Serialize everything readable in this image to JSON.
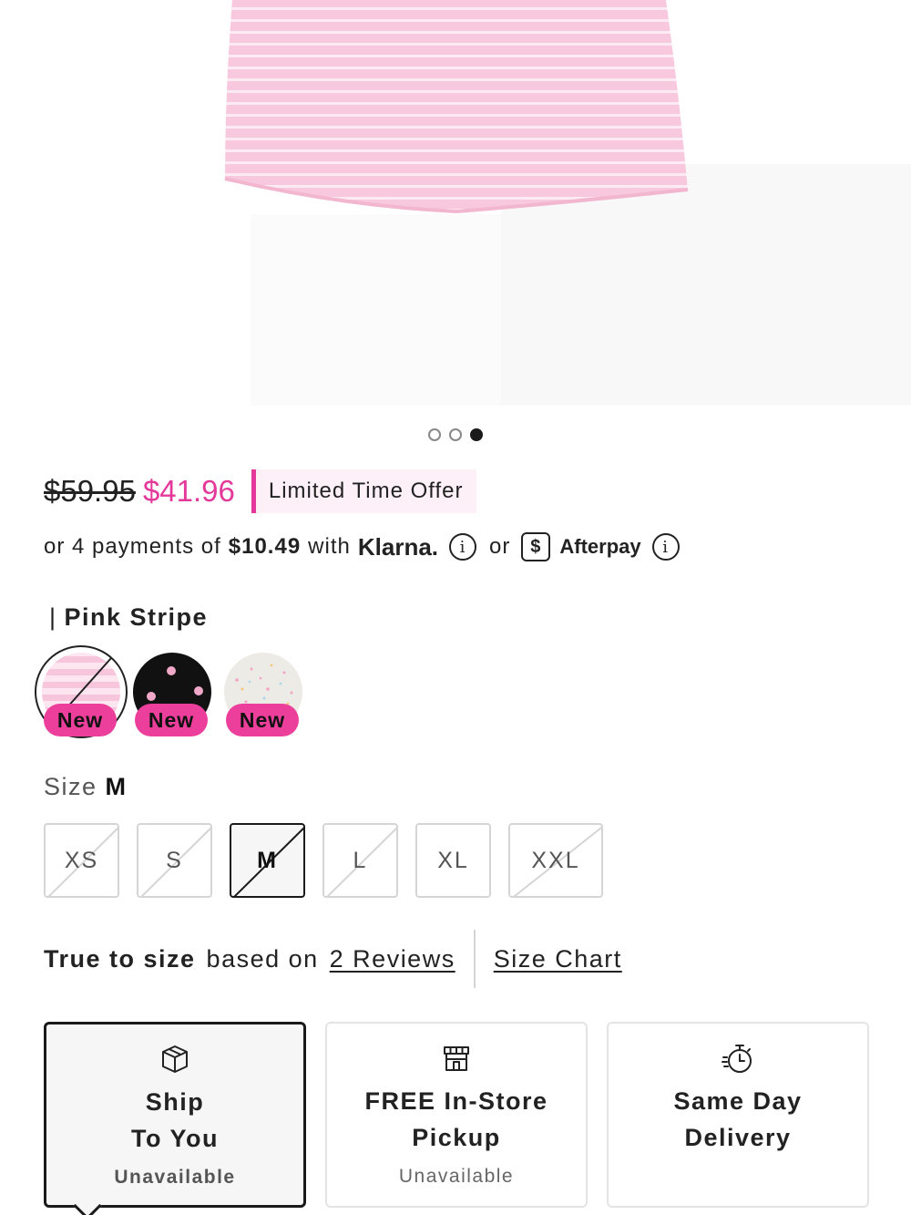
{
  "carousel": {
    "slide_count": 3,
    "active_index": 2
  },
  "price": {
    "original": "$59.95",
    "sale": "$41.96",
    "promo": "Limited Time Offer"
  },
  "payments": {
    "prefix": "or 4 payments of",
    "amount": "$10.49",
    "with": "with",
    "klarna": "Klarna.",
    "or": "or",
    "afterpay_badge": "$",
    "afterpay": "Afterpay",
    "info_icon": "i"
  },
  "color": {
    "bar": "|",
    "selected_name": "Pink Stripe",
    "swatches": [
      {
        "badge": "New",
        "selected": true,
        "unavailable": true
      },
      {
        "badge": "New",
        "selected": false,
        "unavailable": false
      },
      {
        "badge": "New",
        "selected": false,
        "unavailable": false
      }
    ]
  },
  "size": {
    "label": "Size",
    "selected": "M",
    "options": [
      {
        "label": "XS",
        "unavailable": true
      },
      {
        "label": "S",
        "unavailable": true
      },
      {
        "label": "M",
        "unavailable": true,
        "selected": true
      },
      {
        "label": "L",
        "unavailable": true
      },
      {
        "label": "XL",
        "unavailable": false
      },
      {
        "label": "XXL",
        "unavailable": true
      }
    ]
  },
  "fit": {
    "rating": "True to size",
    "based_on": "based on",
    "reviews_link": "2 Reviews",
    "size_chart_link": "Size Chart"
  },
  "delivery": [
    {
      "icon": "box-icon",
      "line1": "Ship",
      "line2": "To You",
      "status": "Unavailable",
      "selected": true
    },
    {
      "icon": "store-icon",
      "line1": "FREE In-Store",
      "line2": "Pickup",
      "status": "Unavailable",
      "selected": false
    },
    {
      "icon": "stopwatch-icon",
      "line1": "Same Day",
      "line2": "Delivery",
      "status": "",
      "selected": false
    }
  ],
  "colors": {
    "accent_pink": "#e4389a",
    "badge_pink": "#ec3e9b",
    "text": "#1a1a1a"
  }
}
